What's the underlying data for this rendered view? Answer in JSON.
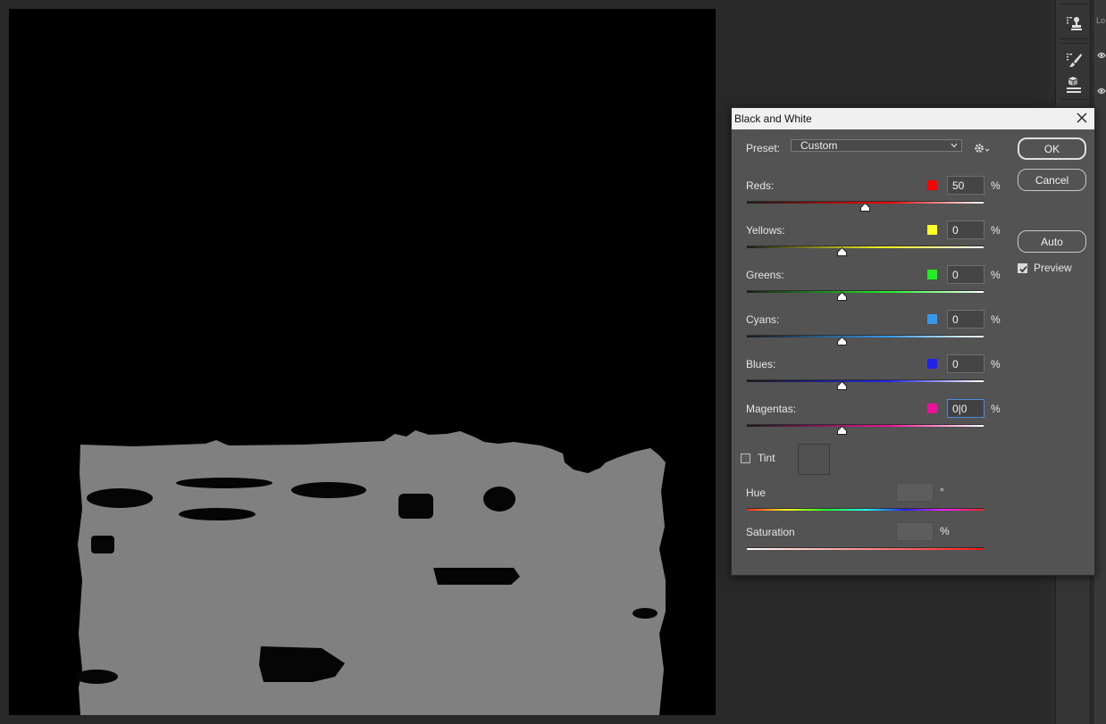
{
  "dialog": {
    "title": "Black and White",
    "preset_label": "Preset:",
    "preset_value": "Custom",
    "buttons": {
      "ok": "OK",
      "cancel": "Cancel",
      "auto": "Auto"
    },
    "preview_label": "Preview",
    "preview_checked": true,
    "percent_sign": "%",
    "sliders": [
      {
        "label": "Reds:",
        "value": "50",
        "percent": 50,
        "color": "#ff0000"
      },
      {
        "label": "Yellows:",
        "value": "0",
        "percent": 0,
        "color": "#ffff22"
      },
      {
        "label": "Greens:",
        "value": "0",
        "percent": 0,
        "color": "#22ee22"
      },
      {
        "label": "Cyans:",
        "value": "0",
        "percent": 0,
        "color": "#3399ee"
      },
      {
        "label": "Blues:",
        "value": "0",
        "percent": 0,
        "color": "#2222ee"
      },
      {
        "label": "Magentas:",
        "value": "0|0",
        "percent": 0,
        "color": "#ee1199",
        "focused": true
      }
    ],
    "tint_label": "Tint",
    "tint_checked": false,
    "hue_label": "Hue",
    "hue_unit": "°",
    "saturation_label": "Saturation",
    "saturation_unit": "%"
  },
  "layers_panel": {
    "edge_text": "Lo"
  },
  "icons": {
    "close": "close-icon",
    "gear": "gear-icon",
    "chevron": "chevron-down-icon",
    "stamp": "stamp-icon",
    "brush": "brush-icon",
    "layers": "layer-styles-icon",
    "eye": "eye-icon"
  }
}
